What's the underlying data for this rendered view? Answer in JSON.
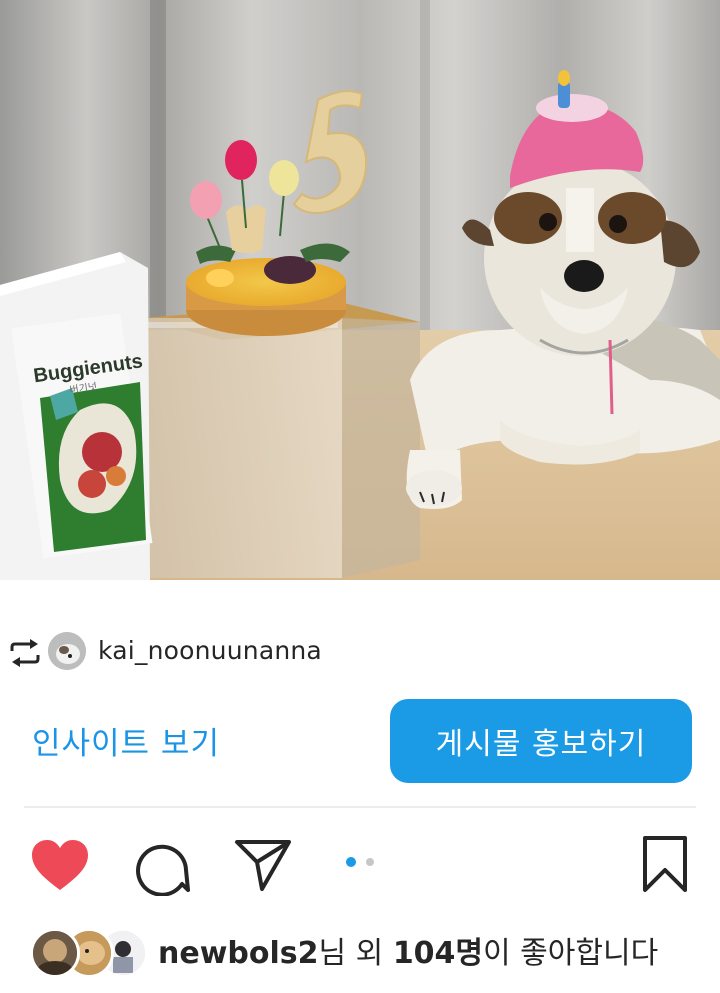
{
  "post": {
    "image_alt": "dog-birthday-photo",
    "package_brand": "Buggienuts",
    "package_sub": "버기넛"
  },
  "repost": {
    "icon": "repost-icon",
    "username": "kai_noonuunanna"
  },
  "actions": {
    "insights_label": "인사이트 보기",
    "promote_label": "게시물 홍보하기"
  },
  "action_bar": {
    "like_icon": "heart-filled-icon",
    "comment_icon": "comment-icon",
    "share_icon": "send-icon",
    "bookmark_icon": "bookmark-icon",
    "carousel_pages": 2,
    "carousel_active": 1
  },
  "likes": {
    "user": "newbols2",
    "text_1": "님 외 ",
    "count": "104명",
    "text_2": "이 좋아합니다"
  },
  "colors": {
    "accent": "#1b9ae6",
    "like_red": "#ed4956",
    "text": "#262626"
  }
}
